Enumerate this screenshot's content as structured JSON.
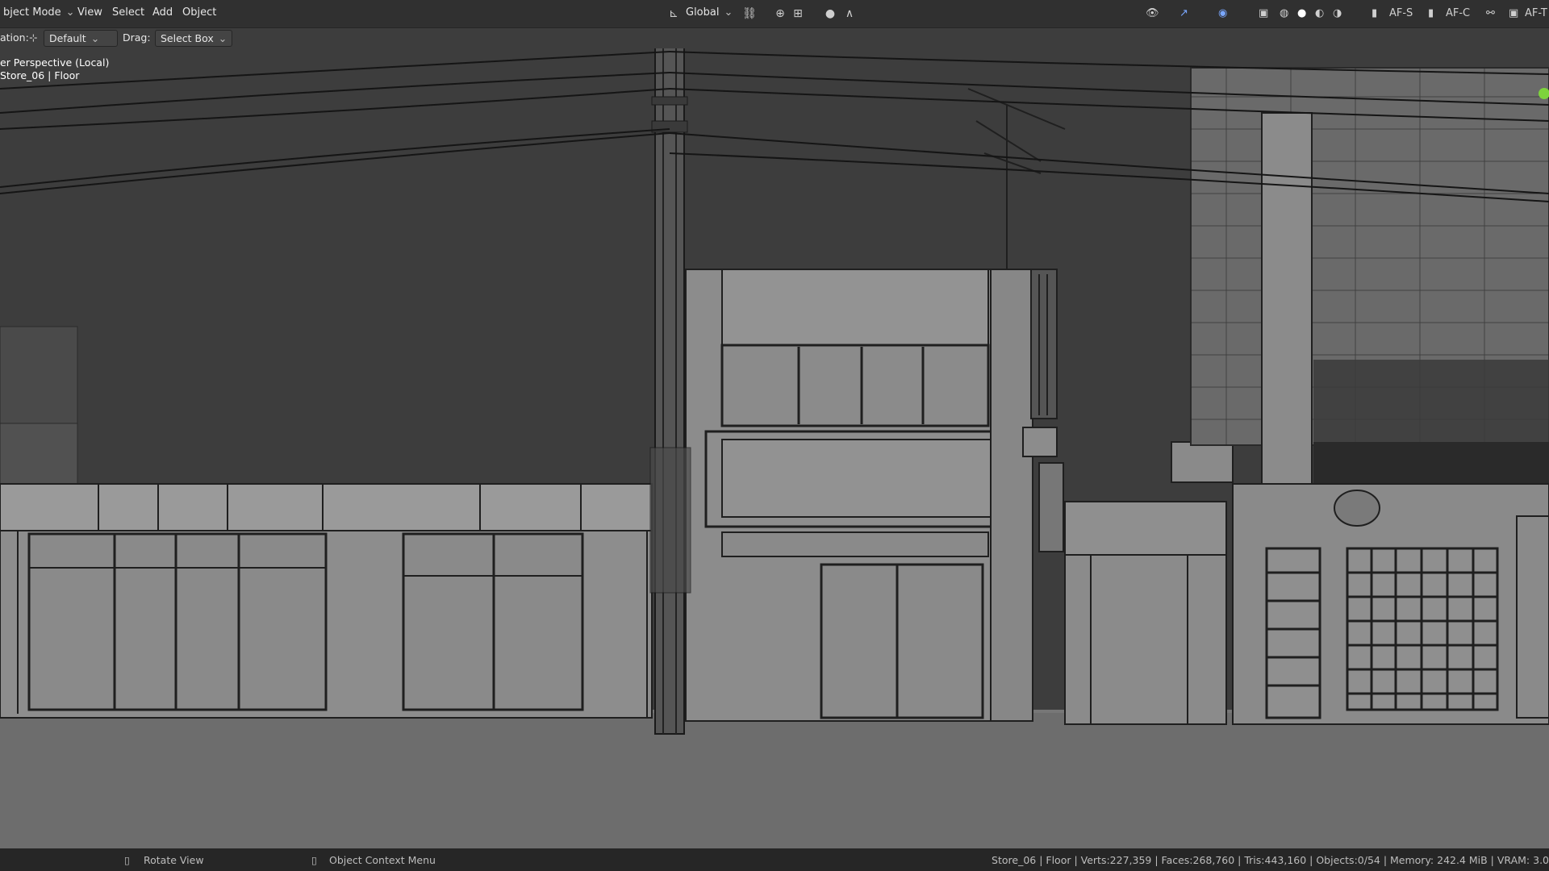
{
  "header": {
    "mode": "bject Mode",
    "menus": [
      "View",
      "Select",
      "Add",
      "Object"
    ],
    "transform_orientation": "Global",
    "right_labels": [
      "AF-S",
      "AF-C",
      "AF-T"
    ]
  },
  "toolbar": {
    "orientation_label": "ation:",
    "orientation_value": "Default",
    "drag_label": "Drag:",
    "drag_value": "Select Box"
  },
  "viewport": {
    "perspective": "er Perspective (Local)",
    "object_info": "Store_06 | Floor"
  },
  "status": {
    "left_hint": "Rotate View",
    "mid_hint": "Object Context Menu",
    "stats": "Store_06 | Floor | Verts:227,359 | Faces:268,760 | Tris:443,160 | Objects:0/54 | Memory: 242.4 MiB | VRAM: 3.0"
  },
  "colors": {
    "sky": "#3d3d3d",
    "ground": "#6d6d6d",
    "building_face": "#8b8b8b",
    "outline": "#1f1f1f",
    "accent_green": "#7dd33c"
  }
}
